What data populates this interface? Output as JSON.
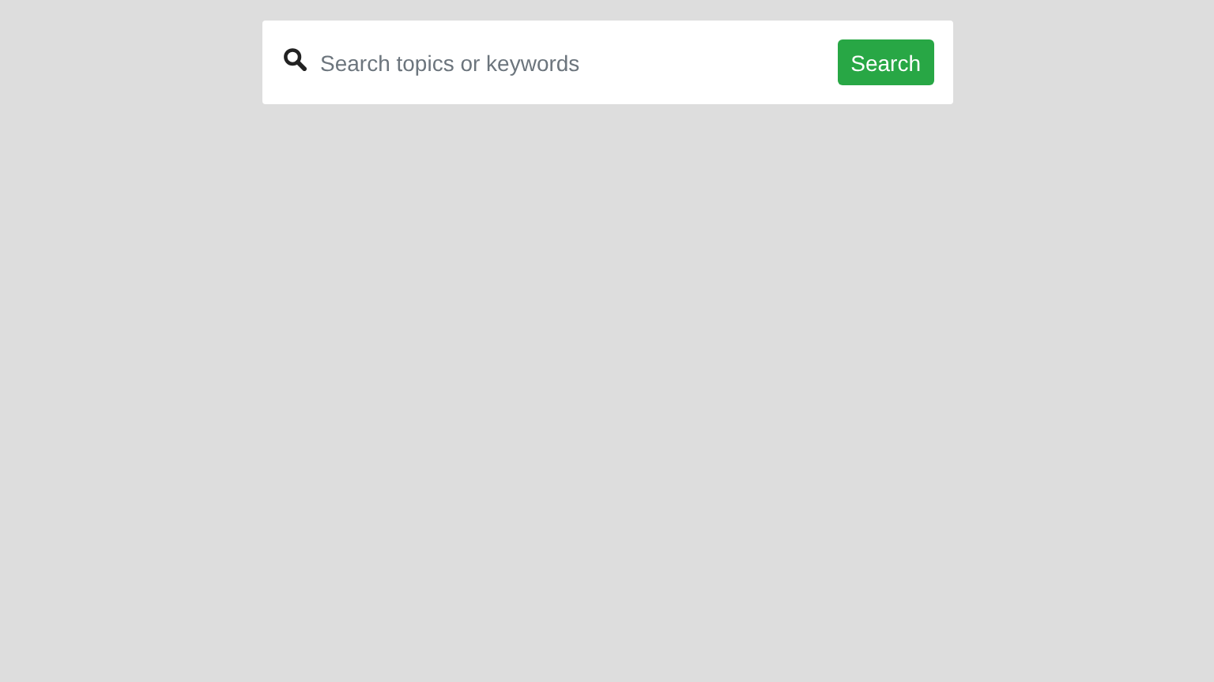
{
  "search": {
    "placeholder": "Search topics or keywords",
    "button": "Search"
  }
}
